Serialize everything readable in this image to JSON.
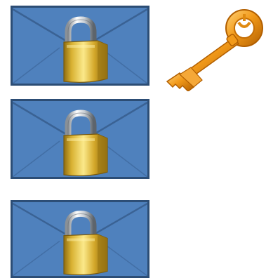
{
  "scene": {
    "envelopes": [
      {
        "icon": "locked-envelope-icon"
      },
      {
        "icon": "locked-envelope-icon"
      },
      {
        "icon": "locked-envelope-icon"
      }
    ],
    "key": {
      "icon": "golden-key-icon"
    }
  },
  "colors": {
    "envelope_fill": "#4f81bd",
    "envelope_border": "#2c4d75",
    "envelope_fold": "#3a6294",
    "padlock_gold": "#d9b233",
    "padlock_dark_gold": "#8f6d12",
    "shackle_silver": "#c7cdd3",
    "key_orange": "#f29a1a",
    "key_dark_orange": "#b25f00"
  }
}
